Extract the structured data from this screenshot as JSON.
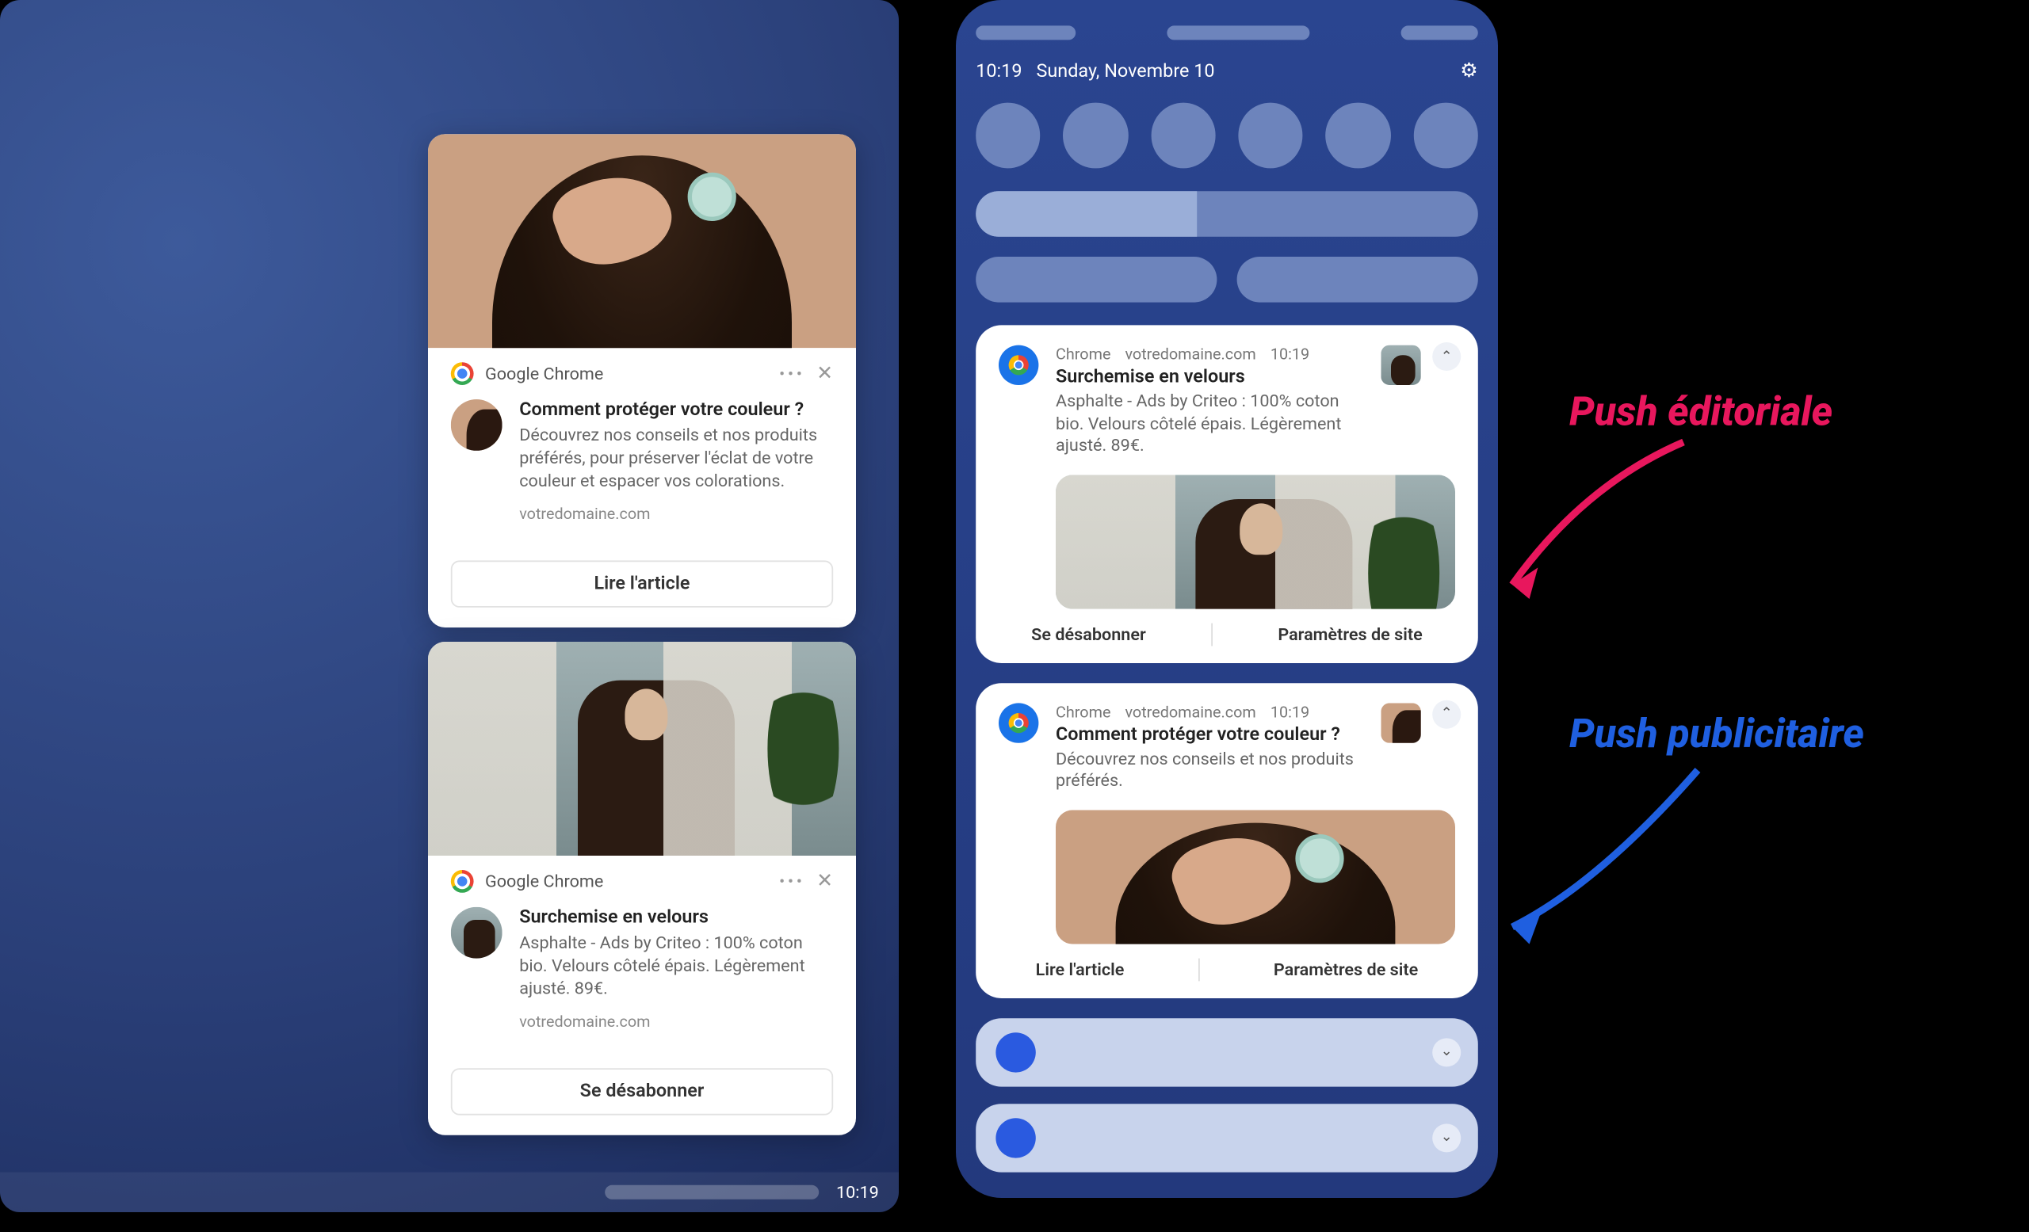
{
  "left": {
    "taskbar_time": "10:19",
    "notif1": {
      "app": "Google Chrome",
      "title": "Comment protéger votre couleur ?",
      "desc": "Découvrez nos conseils et nos produits préférés, pour préserver l'éclat de votre couleur et espacer vos colorations.",
      "domain": "votredomaine.com",
      "cta": "Lire l'article"
    },
    "notif2": {
      "app": "Google Chrome",
      "title": "Surchemise en velours",
      "desc": "Asphalte - Ads by Criteo : 100% coton bio. Velours côtelé épais. Légèrement ajusté. 89€.",
      "domain": "votredomaine.com",
      "cta": "Se désabonner"
    }
  },
  "phone": {
    "time": "10:19",
    "date": "Sunday, Novembre 10",
    "notif1": {
      "app": "Chrome",
      "domain": "votredomaine.com",
      "time": "10:19",
      "title": "Surchemise en velours",
      "desc": "Asphalte - Ads by Criteo : 100% coton bio. Velours côtelé épais. Légèrement ajusté. 89€.",
      "action1": "Se désabonner",
      "action2": "Paramètres de site"
    },
    "notif2": {
      "app": "Chrome",
      "domain": "votredomaine.com",
      "time": "10:19",
      "title": "Comment protéger votre couleur ?",
      "desc": "Découvrez nos conseils et nos produits préférés.",
      "action1": "Lire l'article",
      "action2": "Paramètres de site"
    }
  },
  "annotations": {
    "editorial": "Push éditoriale",
    "ad": "Push publicitaire"
  }
}
